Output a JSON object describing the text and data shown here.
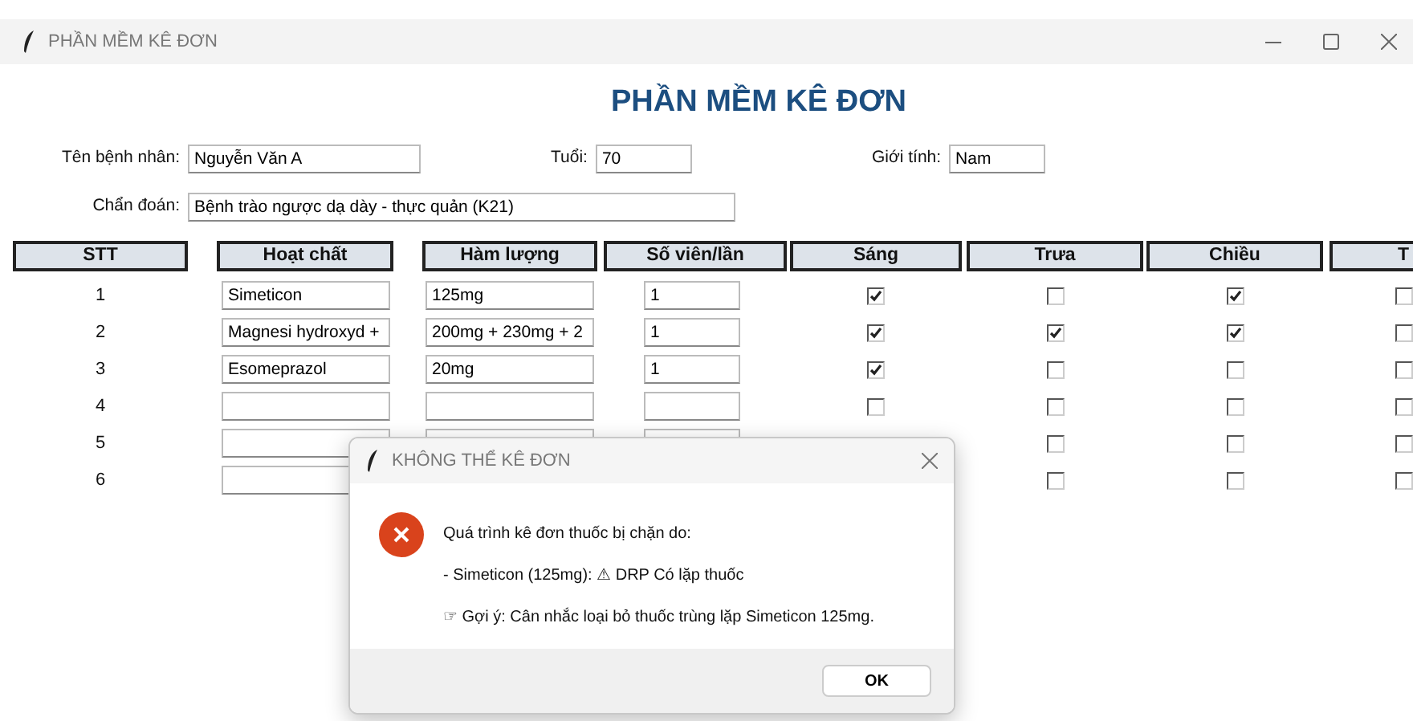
{
  "window": {
    "title": "PHẦN MỀM KÊ ĐƠN"
  },
  "heading": "PHẦN MỀM KÊ ĐƠN",
  "patient": {
    "name_label": "Tên bệnh nhân:",
    "name": "Nguyễn Văn A",
    "age_label": "Tuổi:",
    "age": "70",
    "gender_label": "Giới tính:",
    "gender": "Nam",
    "diagnosis_label": "Chẩn đoán:",
    "diagnosis": "Bệnh trào ngược dạ dày - thực quản (K21)"
  },
  "table": {
    "columns": [
      "STT",
      "Hoạt chất",
      "Hàm lượng",
      "Số viên/lần",
      "Sáng",
      "Trưa",
      "Chiều",
      "T"
    ],
    "rows": [
      {
        "stt": "1",
        "active": "Simeticon",
        "strength": "125mg",
        "quantity": "1",
        "morning": {
          "checked": true
        },
        "noon": {
          "checked": false
        },
        "afternoon": {
          "checked": true
        },
        "evening": {
          "checked": false
        }
      },
      {
        "stt": "2",
        "active": "Magnesi hydroxyd +",
        "strength": "200mg + 230mg + 2",
        "quantity": "1",
        "morning": {
          "checked": true
        },
        "noon": {
          "checked": true
        },
        "afternoon": {
          "checked": true
        },
        "evening": {
          "checked": false
        }
      },
      {
        "stt": "3",
        "active": "Esomeprazol",
        "strength": "20mg",
        "quantity": "1",
        "morning": {
          "checked": true
        },
        "noon": {
          "checked": false
        },
        "afternoon": {
          "checked": false
        },
        "evening": {
          "checked": false
        }
      },
      {
        "stt": "4",
        "kind": "blank",
        "morning": {
          "checked": false
        },
        "noon": {
          "checked": false
        },
        "afternoon": {
          "checked": false
        },
        "evening": {
          "checked": false
        }
      },
      {
        "stt": "5",
        "kind": "blank",
        "noon": {
          "checked": false
        },
        "afternoon": {
          "checked": false
        },
        "evening": {
          "checked": false
        }
      },
      {
        "stt": "6",
        "noon": {
          "checked": false
        },
        "afternoon": {
          "checked": false
        },
        "evening": {
          "checked": false
        }
      }
    ]
  },
  "dialog": {
    "title": "KHÔNG THỂ KÊ ĐƠN",
    "lines": [
      "Quá trình kê đơn thuốc bị chặn do:",
      "- Simeticon (125mg): ⚠ DRP Có lặp thuốc",
      "☞ Gợi ý: Cân nhắc loại bỏ thuốc trùng lặp Simeticon 125mg."
    ],
    "button": "OK"
  }
}
